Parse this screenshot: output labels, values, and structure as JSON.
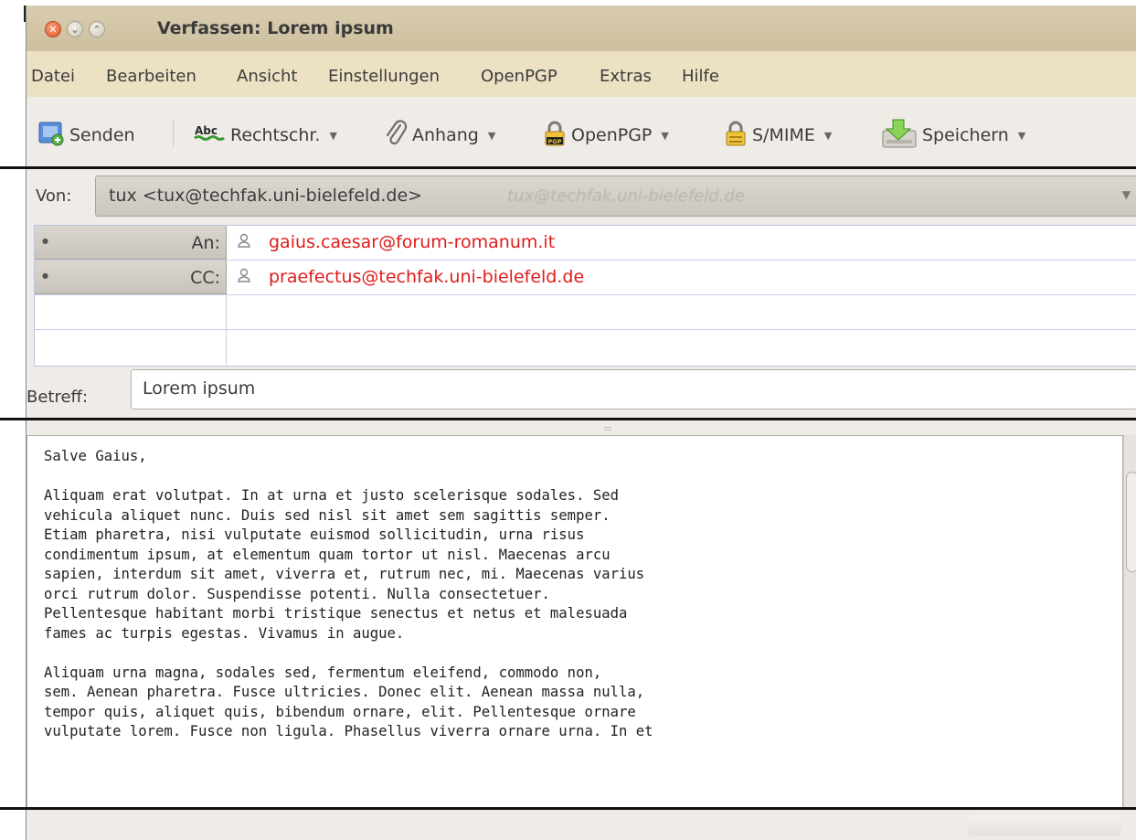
{
  "window": {
    "title": "Verfassen: Lorem ipsum"
  },
  "menu": [
    {
      "label": "Datei"
    },
    {
      "label": "Bearbeiten"
    },
    {
      "label": "Ansicht"
    },
    {
      "label": "Einstellungen"
    },
    {
      "label": "OpenPGP"
    },
    {
      "label": "Extras"
    },
    {
      "label": "Hilfe"
    }
  ],
  "toolbar": {
    "send": {
      "label": "Senden",
      "icon": "send-icon"
    },
    "spell": {
      "label": "Rechtschr.",
      "icon": "spellcheck-icon"
    },
    "attach": {
      "label": "Anhang",
      "icon": "paperclip-icon"
    },
    "openpgp": {
      "label": "OpenPGP",
      "icon": "pgp-lock-icon"
    },
    "smime": {
      "label": "S/MIME",
      "icon": "lock-icon"
    },
    "save": {
      "label": "Speichern",
      "icon": "save-icon"
    },
    "dropdown_glyph": "▼"
  },
  "from": {
    "label": "Von:",
    "value": "tux <tux@techfak.uni-bielefeld.de>",
    "ghost": "tux@techfak.uni-bielefeld.de"
  },
  "recipients": [
    {
      "type": "An:",
      "address": "gaius.caesar@forum-romanum.it"
    },
    {
      "type": "CC:",
      "address": "praefectus@techfak.uni-bielefeld.de"
    }
  ],
  "subject": {
    "label": "Betreff:",
    "value": "Lorem ipsum"
  },
  "body": {
    "text": "Salve Gaius,\n\nAliquam erat volutpat. In at urna et justo scelerisque sodales. Sed\nvehicula aliquet nunc. Duis sed nisl sit amet sem sagittis semper.\nEtiam pharetra, nisi vulputate euismod sollicitudin, urna risus\ncondimentum ipsum, at elementum quam tortor ut nisl. Maecenas arcu\nsapien, interdum sit amet, viverra et, rutrum nec, mi. Maecenas varius\norci rutrum dolor. Suspendisse potenti. Nulla consectetuer.\nPellentesque habitant morbi tristique senectus et netus et malesuada\nfames ac turpis egestas. Vivamus in augue.\n\nAliquam urna magna, sodales sed, fermentum eleifend, commodo non,\nsem. Aenean pharetra. Fusce ultricies. Donec elit. Aenean massa nulla,\ntempor quis, aliquet quis, bibendum ornare, elit. Pellentesque ornare\nvulputate lorem. Fusce non ligula. Phasellus viverra ornare urna. In et"
  },
  "colors": {
    "titlebar": "#d4c7a8",
    "menubar": "#ede1c4",
    "recipient_address": "#e01b1b"
  }
}
